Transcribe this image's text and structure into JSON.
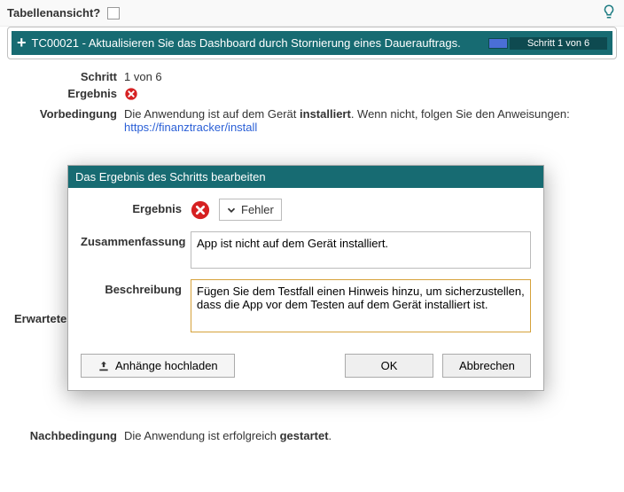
{
  "topbar": {
    "tableview_label": "Tabellenansicht?"
  },
  "tc": {
    "title": "TC00021 - Aktualisieren Sie das Dashboard durch Stornierung eines Dauerauftrags.",
    "progress": "Schritt 1 von 6"
  },
  "details": {
    "step_label": "Schritt",
    "step_value": "1 von 6",
    "result_label": "Ergebnis",
    "precond_label": "Vorbedingung",
    "precond_text_before": "Die Anwendung ist auf dem Gerät ",
    "precond_bold": "installiert",
    "precond_text_after": ". Wenn nicht, folgen Sie den Anweisungen: ",
    "precond_link": "https://finanztracker/install",
    "expected_label": "Erwartetes",
    "postcond_label": "Nachbedingung",
    "postcond_before": "Die Anwendung ist erfolgreich ",
    "postcond_bold": "gestartet",
    "postcond_after": "."
  },
  "modal": {
    "title": "Das Ergebnis des Schritts bearbeiten",
    "result_label": "Ergebnis",
    "result_value": "Fehler",
    "summary_label": "Zusammenfassung",
    "summary_value": "App ist nicht auf dem Gerät installiert.",
    "desc_label": "Beschreibung",
    "desc_value": "Fügen Sie dem Testfall einen Hinweis hinzu, um sicherzustellen, dass die App vor dem Testen auf dem Gerät installiert ist.",
    "upload_label": "Anhänge hochladen",
    "ok": "OK",
    "cancel": "Abbrechen"
  }
}
